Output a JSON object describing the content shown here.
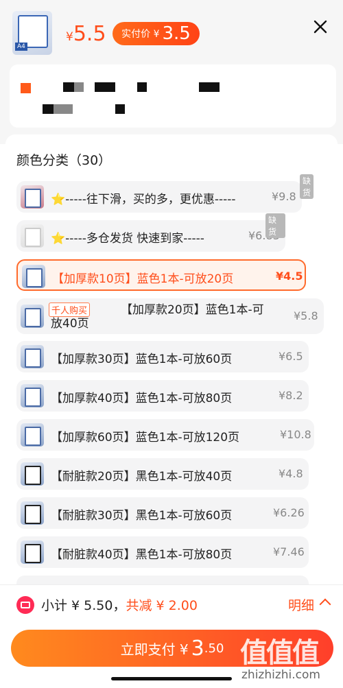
{
  "header": {
    "price_yen": "¥",
    "price": "5.5",
    "pay_label": "实付价 ¥",
    "pay_price": "3.5",
    "thumb_tag": "A4"
  },
  "section": {
    "title": "颜色分类（30）"
  },
  "options": [
    {
      "text": "-----往下滑，买的多，更优惠-----",
      "price": "¥9.8",
      "star": "⭐",
      "badge": "缺货"
    },
    {
      "text": "-----多仓发货 快速到家-----",
      "price": "¥6.83",
      "star": "⭐",
      "badge": "缺货"
    },
    {
      "text": "【加厚款10页】蓝色1本-可放20页",
      "price": "¥4.5"
    },
    {
      "tag": "千人购买",
      "line1": "【加厚款20页】蓝色1本-可",
      "line2": "放40页",
      "price": "¥5.8"
    },
    {
      "text": "【加厚款30页】蓝色1本-可放60页",
      "price": "¥6.5"
    },
    {
      "text": "【加厚款40页】蓝色1本-可放80页",
      "price": "¥8.2"
    },
    {
      "text": "【加厚款60页】蓝色1本-可放120页",
      "price": "¥10.8"
    },
    {
      "text": "【耐脏款20页】黑色1本-可放40页",
      "price": "¥4.8"
    },
    {
      "text": "【耐脏款30页】黑色1本-可放60页",
      "price": "¥6.26"
    },
    {
      "text": "【耐脏款40页】黑色1本-可放80页",
      "price": "¥7.46"
    }
  ],
  "footer": {
    "subtotal_label": "小计 ¥ 5.50，",
    "discount_label": "共减 ¥ 2.00",
    "detail_label": "明细",
    "pay_button_label": "立即支付 ¥",
    "pay_button_amount": "3",
    "pay_button_decimal": ".50"
  },
  "watermark": {
    "text": "值值值",
    "url": "zhizhizhi.com"
  },
  "colors": {
    "accent": "#ff4d1a",
    "button_start": "#ff8a1e",
    "button_end": "#ff3f2a"
  }
}
